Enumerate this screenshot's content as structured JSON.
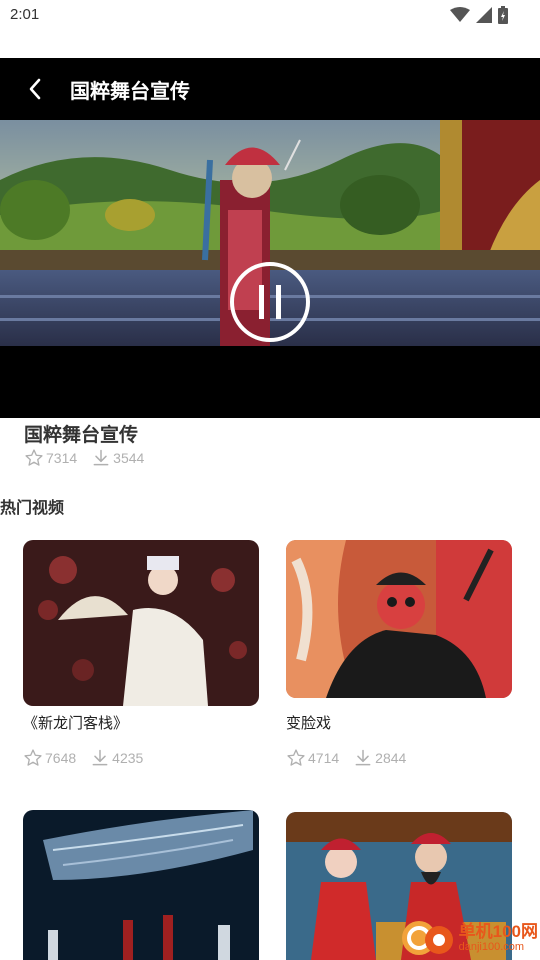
{
  "status_bar": {
    "time": "2:01"
  },
  "header": {
    "title": "国粹舞台宣传"
  },
  "player": {
    "state": "playing",
    "control_icon": "pause-icon"
  },
  "video": {
    "title": "国粹舞台宣传",
    "stars": "7314",
    "downloads": "3544"
  },
  "section": {
    "title": "热门视频"
  },
  "hot_videos": [
    {
      "title": "《新龙门客栈》",
      "stars": "7648",
      "downloads": "4235"
    },
    {
      "title": "变脸戏",
      "stars": "4714",
      "downloads": "2844"
    },
    {
      "title": "",
      "stars": "",
      "downloads": ""
    },
    {
      "title": "",
      "stars": "",
      "downloads": ""
    }
  ],
  "watermark": {
    "main": "单机100网",
    "sub": "danji100.com"
  },
  "colors": {
    "accent": "#e8571b",
    "stat_gray": "#b0b0b0",
    "video_bg": "#000000"
  }
}
